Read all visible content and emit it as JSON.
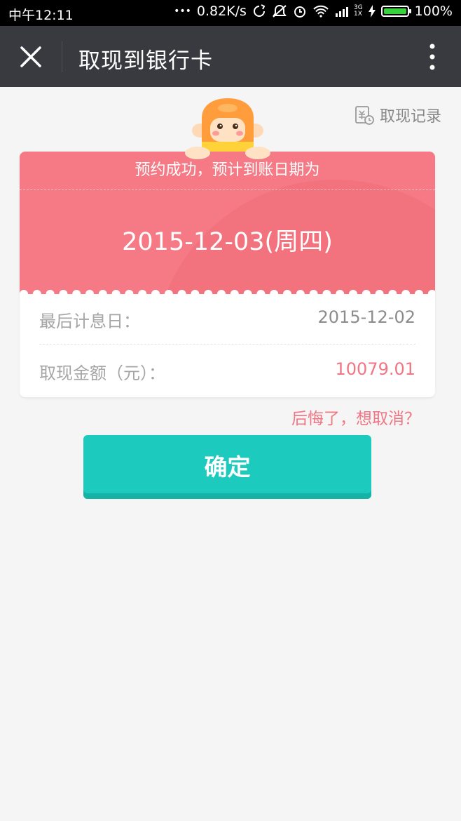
{
  "status_bar": {
    "time": "中午12:11",
    "dots": "•••",
    "speed": "0.82K/s",
    "network": "3G",
    "network_sub": "1X",
    "battery": "100%",
    "battery_level": 1.0,
    "icons": [
      "sync-icon",
      "mute-icon",
      "alarm-icon",
      "wifi-icon",
      "signal-icon",
      "charging-icon"
    ]
  },
  "nav": {
    "title": "取现到银行卡",
    "close_icon": "close-icon",
    "more_icon": "more-vertical-icon"
  },
  "history": {
    "label": "取现记录",
    "icon": "history-record-icon"
  },
  "ticket": {
    "label": "预约成功，预计到账日期为",
    "date": "2015-12-03(周四)",
    "colors": {
      "top": "#f57a85",
      "shade": "#ee6c79"
    }
  },
  "details": [
    {
      "label": "最后计息日：",
      "value": "2015-12-02",
      "value_color": "#8c8c8c"
    },
    {
      "label": "取现金额（元）：",
      "value": "10079.01",
      "value_color": "#f07684"
    }
  ],
  "cancel": {
    "label": "后悔了，想取消？",
    "color": "#f07684"
  },
  "confirm": {
    "label": "确定",
    "color": "#1ccbbd"
  }
}
